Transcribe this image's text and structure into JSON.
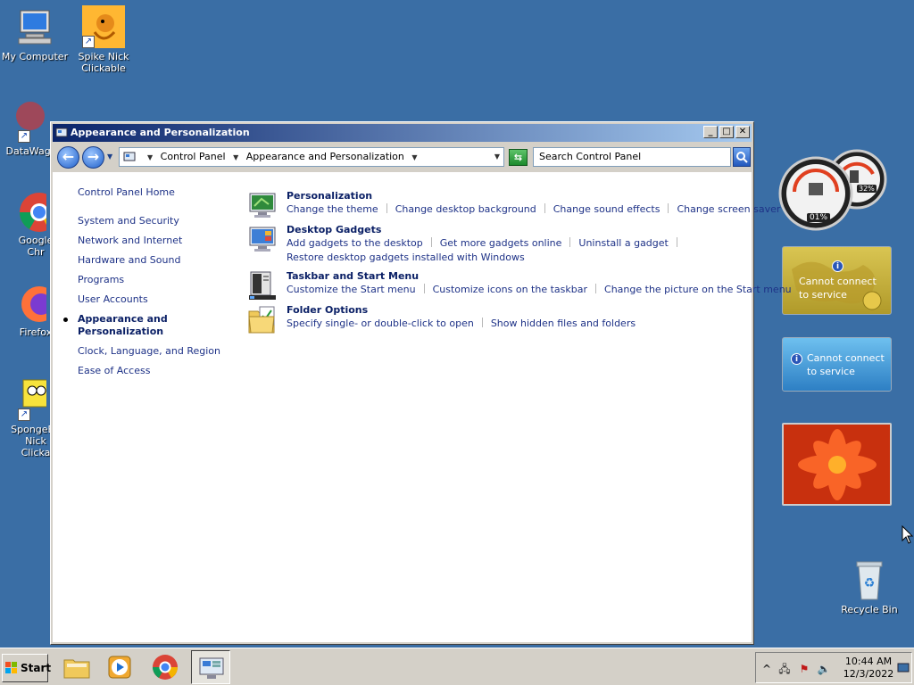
{
  "desktop": {
    "icons": [
      {
        "label_lines": [
          "My Computer"
        ]
      },
      {
        "label_lines": [
          "Spike Nick",
          "Clickable"
        ]
      },
      {
        "label_lines": [
          "DataWago"
        ]
      },
      {
        "label_lines": [
          "Google Chr"
        ]
      },
      {
        "label_lines": [
          "Firefox"
        ]
      },
      {
        "label_lines": [
          "SpongeBo",
          "Nick Clicka"
        ]
      },
      {
        "label_lines": [
          "Recycle Bin"
        ]
      }
    ]
  },
  "gadgets": {
    "cpu_meter": {
      "cpu": "01%",
      "memory": "32%"
    },
    "geo_message": [
      "Cannot connect",
      "to service"
    ],
    "rss_message": [
      "Cannot connect",
      "to service"
    ]
  },
  "window": {
    "title": "Appearance and Personalization",
    "controls": {
      "minimize": "_",
      "maximize": "□",
      "close": "✕"
    },
    "address": {
      "segments": [
        "Control Panel",
        "Appearance and Personalization"
      ]
    },
    "search_placeholder": "Search Control Panel",
    "leftnav": {
      "home": "Control Panel Home",
      "items": [
        {
          "label": "System and Security"
        },
        {
          "label": "Network and Internet"
        },
        {
          "label": "Hardware and Sound"
        },
        {
          "label": "Programs"
        },
        {
          "label": "User Accounts"
        },
        {
          "label_lines": [
            "Appearance and",
            "Personalization"
          ],
          "current": true
        },
        {
          "label": "Clock, Language, and Region"
        },
        {
          "label": "Ease of Access"
        }
      ]
    },
    "sections": [
      {
        "title": "Personalization",
        "icon": "personalization-icon",
        "link_rows": [
          [
            "Change the theme",
            "Change desktop background",
            "Change sound effects",
            "Change screen saver"
          ]
        ]
      },
      {
        "title": "Desktop Gadgets",
        "icon": "gadgets-icon",
        "link_rows": [
          [
            "Add gadgets to the desktop",
            "Get more gadgets online",
            "Uninstall a gadget"
          ],
          [
            "Restore desktop gadgets installed with Windows"
          ]
        ]
      },
      {
        "title": "Taskbar and Start Menu",
        "icon": "taskbar-icon",
        "link_rows": [
          [
            "Customize the Start menu",
            "Customize icons on the taskbar",
            "Change the picture on the Start menu"
          ]
        ]
      },
      {
        "title": "Folder Options",
        "icon": "folder-options-icon",
        "link_rows": [
          [
            "Specify single- or double-click to open",
            "Show hidden files and folders"
          ]
        ]
      }
    ]
  },
  "taskbar": {
    "start_label": "Start",
    "apps": [
      {
        "name": "file-explorer"
      },
      {
        "name": "media-player"
      },
      {
        "name": "chrome"
      },
      {
        "name": "control-panel",
        "active": true
      }
    ],
    "tray_expand": "^",
    "clock": {
      "time": "10:44 AM",
      "date": "12/3/2022"
    }
  },
  "colors": {
    "desktop_bg": "#3a6ea5",
    "link": "#1e3287",
    "title_dark": "#0b2066"
  }
}
